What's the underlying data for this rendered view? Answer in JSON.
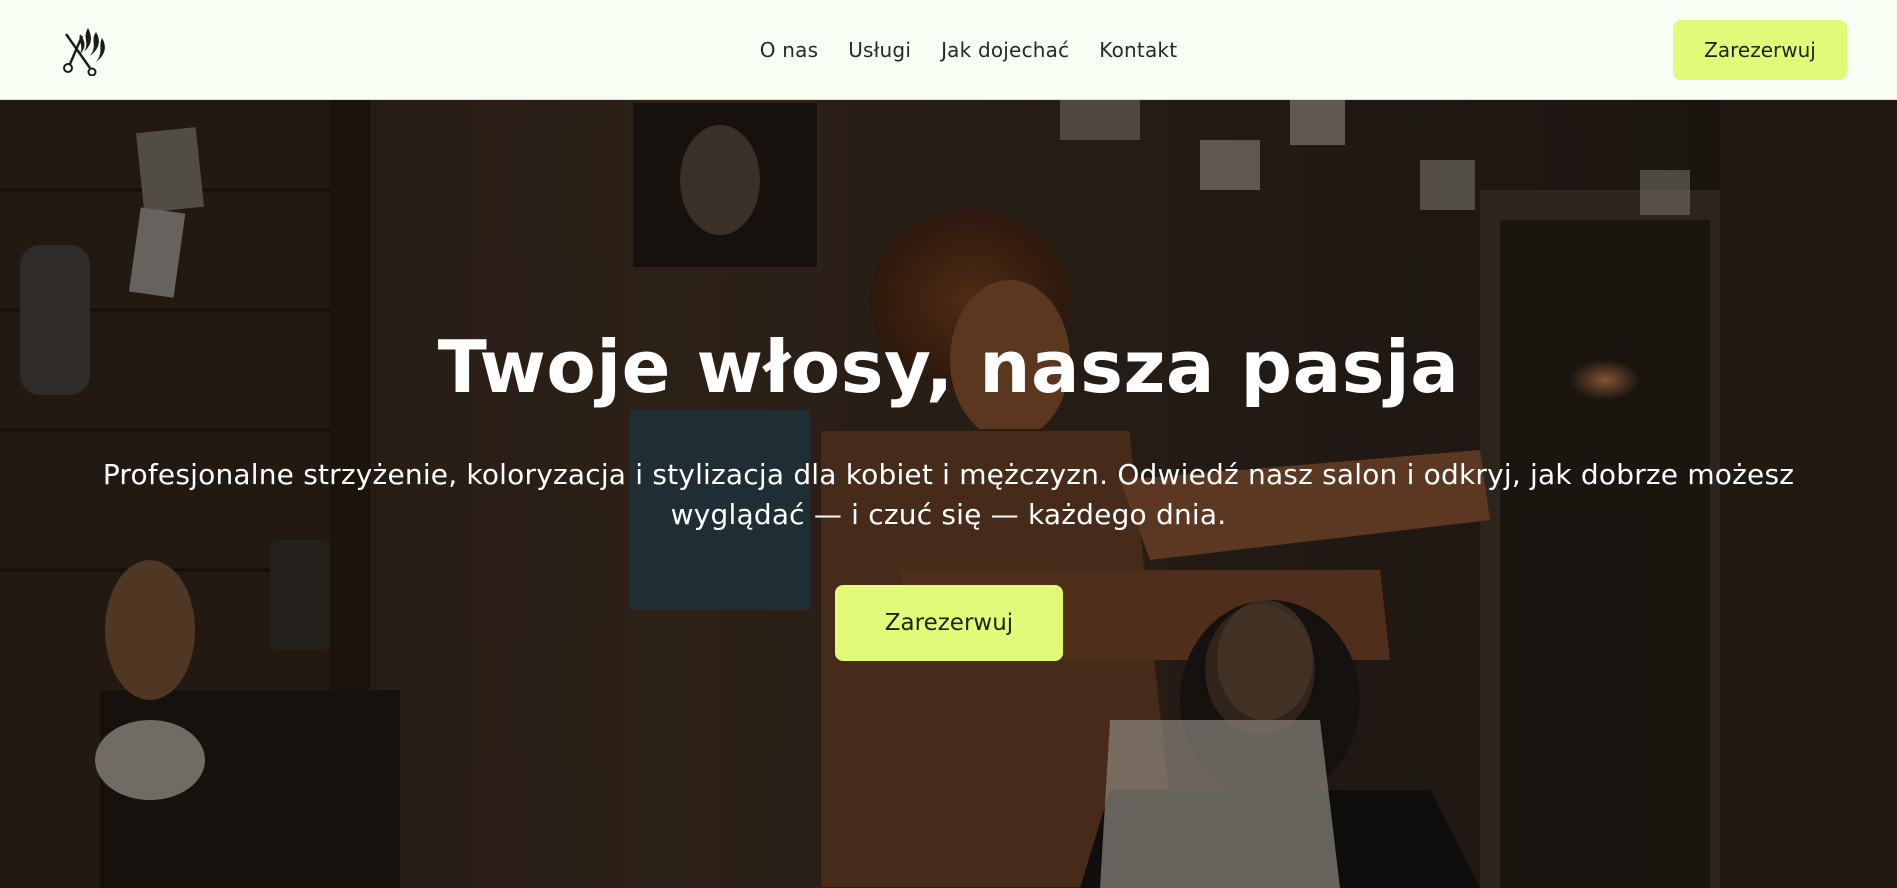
{
  "header": {
    "logo_icon": "scissors-comb-logo-icon",
    "nav": [
      {
        "label": "O nas"
      },
      {
        "label": "Usługi"
      },
      {
        "label": "Jak dojechać"
      },
      {
        "label": "Kontakt"
      }
    ],
    "cta_label": "Zarezerwuj",
    "background_color": "#f7fef3"
  },
  "hero": {
    "title": "Twoje włosy, nasza pasja",
    "subtitle": "Profesjonalne strzyżenie, koloryzacja i stylizacja dla kobiet i mężczyzn. Odwiedź nasz salon i odkryj, jak dobrze możesz wyglądać — i czuć się — każdego dnia.",
    "cta_label": "Zarezerwuj",
    "background_image": "barbershop-photo"
  },
  "colors": {
    "accent": "#e1fb79",
    "header_bg": "#f7fef3",
    "text_dark": "#262a24",
    "hero_text": "#ffffff"
  }
}
